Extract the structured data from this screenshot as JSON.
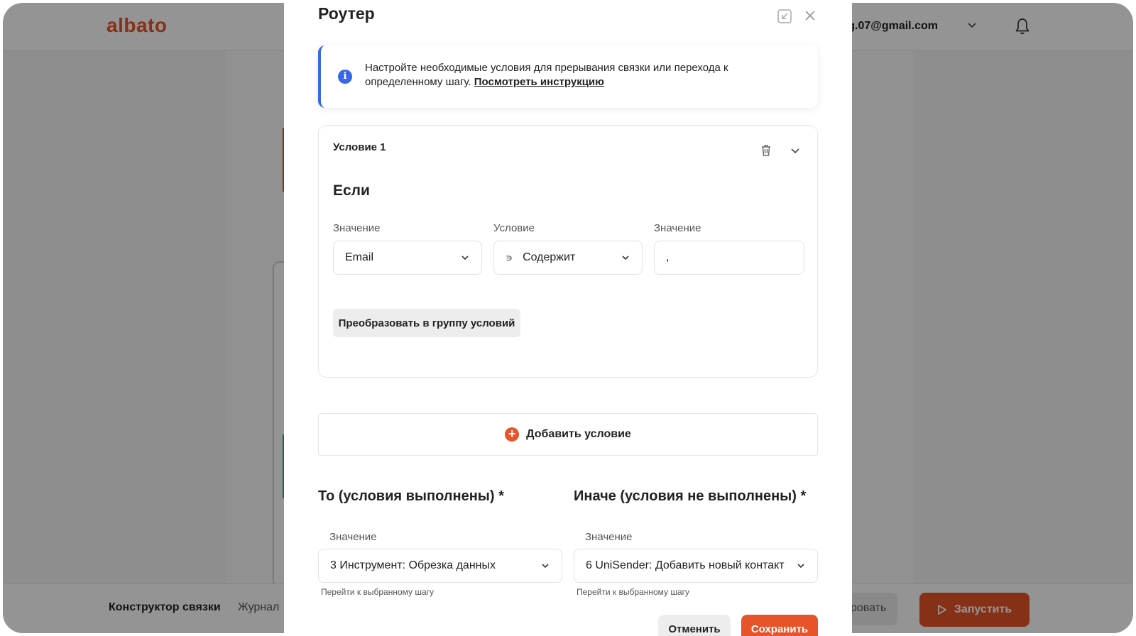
{
  "app": {
    "logo": "albato",
    "user_email": "ing.07@gmail.com"
  },
  "bottom_bar": {
    "tab_constructor": "Конструктор связки",
    "tab_journal": "Журнал",
    "hidden_button": "ровать",
    "run_button": "Запустить"
  },
  "modal": {
    "title": "Роутер",
    "info": {
      "text": "Настройте необходимые условия для прерывания связки или перехода к определенному шагу.",
      "link": "Посмотреть инструкцию"
    },
    "condition": {
      "title": "Условие 1",
      "if_label": "Если",
      "value_label": "Значение",
      "value_selected": "Email",
      "operator_label": "Условие",
      "operator_prefix": "∍",
      "operator_selected": "Содержит",
      "value2_label": "Значение",
      "value2_input": ",",
      "group_button": "Преобразовать в группу условий"
    },
    "add_condition": "Добавить условие",
    "then": {
      "heading": "То (условия выполнены) *",
      "label": "Значение",
      "selected": "3 Инструмент: Обрезка данных",
      "hint": "Перейти к выбранному шагу"
    },
    "else": {
      "heading": "Иначе (условия не выполнены) *",
      "label": "Значение",
      "selected": "6 UniSender: Добавить новый контакт",
      "hint": "Перейти к выбранному шагу"
    },
    "cancel_button": "Отменить",
    "save_button": "Сохранить"
  },
  "colors": {
    "accent": "#e8542a",
    "info": "#3867e8",
    "overlay": "rgba(0,0,0,0.42)"
  },
  "icons": [
    "bell-icon",
    "chevron-down-icon",
    "collapse-icon",
    "close-icon",
    "info-icon",
    "trash-icon",
    "plus-circle-icon",
    "play-icon"
  ]
}
